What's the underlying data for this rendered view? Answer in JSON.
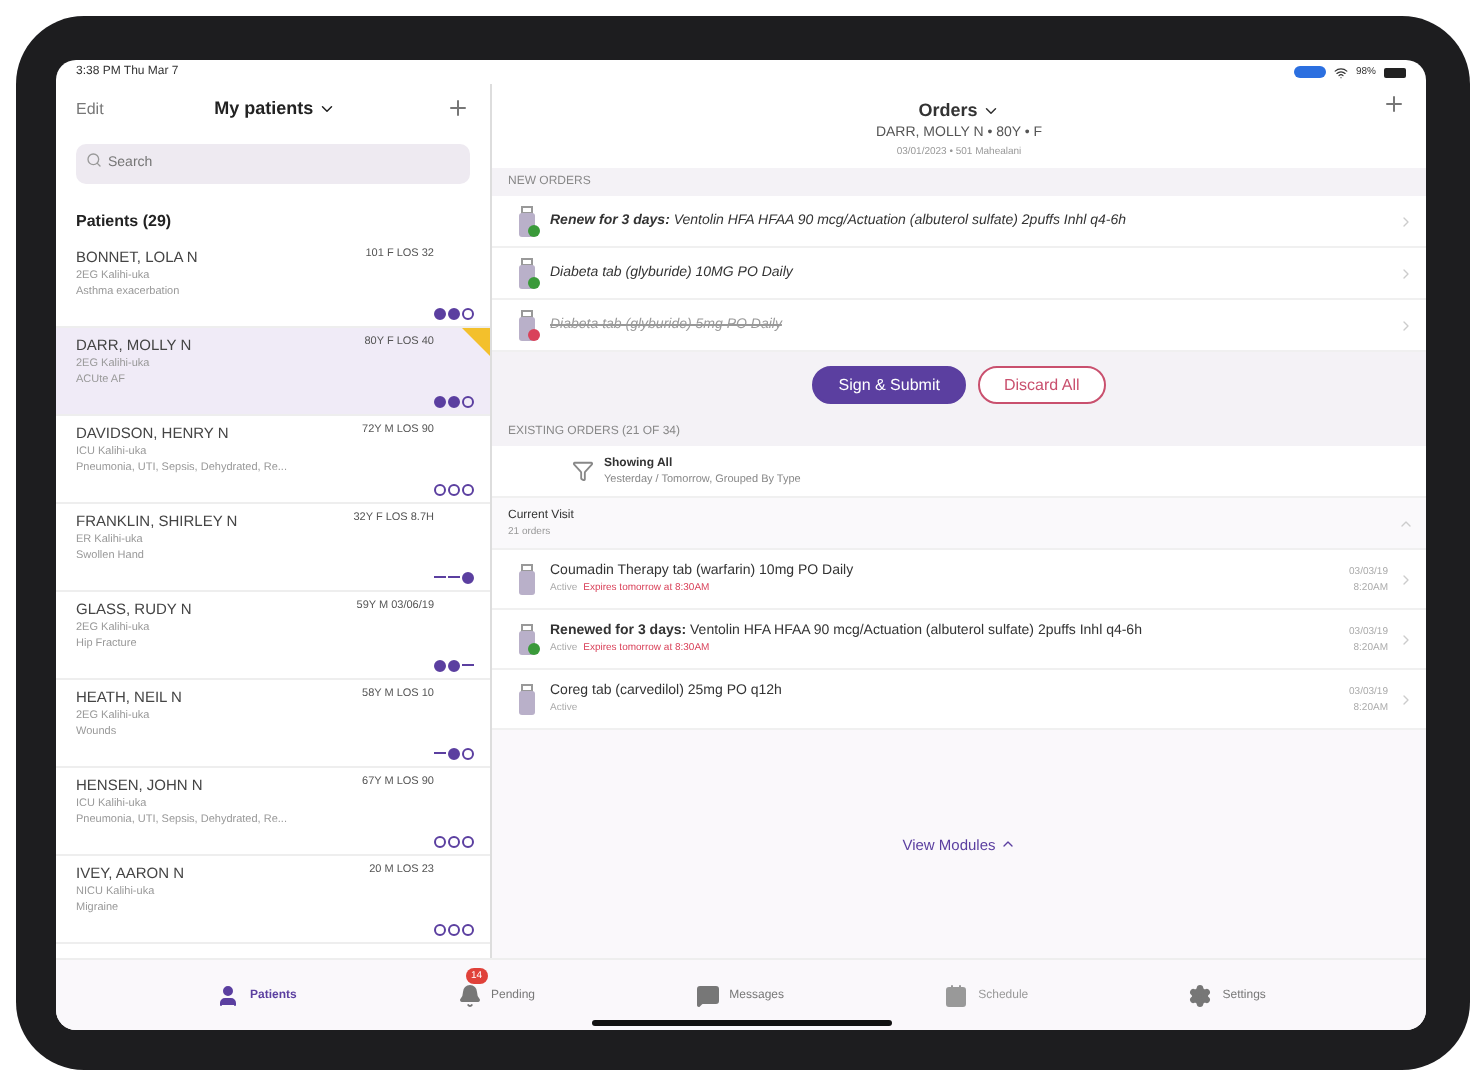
{
  "status_bar": {
    "time": "3:38 PM  Thu Mar 7",
    "battery": "98%"
  },
  "sidebar": {
    "edit": "Edit",
    "title": "My patients",
    "search": {
      "placeholder": "Search"
    },
    "list_title": "Patients (29)",
    "patients": [
      {
        "name": "BONNET, LOLA N",
        "info": "101 F LOS 32",
        "location": "2EG Kalihi-uka",
        "diagnosis": "Asthma exacerbation",
        "selected": false,
        "flagged": false,
        "indicators": [
          {
            "kind": "filled"
          },
          {
            "kind": "filled"
          },
          {
            "kind": "empty"
          }
        ]
      },
      {
        "name": "DARR, MOLLY N",
        "info": "80Y F LOS 40",
        "location": "2EG Kalihi-uka",
        "diagnosis": "ACUte AF",
        "selected": true,
        "flagged": true,
        "indicators": [
          {
            "kind": "filled"
          },
          {
            "kind": "filled"
          },
          {
            "kind": "empty"
          }
        ]
      },
      {
        "name": "DAVIDSON, HENRY N",
        "info": "72Y M LOS 90",
        "location": "ICU Kalihi-uka",
        "diagnosis": "Pneumonia, UTI, Sepsis, Dehydrated, Re...",
        "selected": false,
        "flagged": false,
        "indicators": [
          {
            "kind": "empty"
          },
          {
            "kind": "empty"
          },
          {
            "kind": "empty"
          }
        ]
      },
      {
        "name": "FRANKLIN, SHIRLEY N",
        "info": "32Y F LOS 8.7H",
        "location": "ER Kalihi-uka",
        "diagnosis": "Swollen Hand",
        "selected": false,
        "flagged": false,
        "indicators": [
          {
            "kind": "dash"
          },
          {
            "kind": "dash"
          },
          {
            "kind": "filled"
          }
        ]
      },
      {
        "name": "GLASS, RUDY N",
        "info": "59Y M 03/06/19",
        "location": "2EG Kalihi-uka",
        "diagnosis": "Hip Fracture",
        "selected": false,
        "flagged": false,
        "indicators": [
          {
            "kind": "filled"
          },
          {
            "kind": "filled"
          },
          {
            "kind": "dash"
          }
        ]
      },
      {
        "name": "HEATH, NEIL N",
        "info": "58Y M LOS 10",
        "location": "2EG Kalihi-uka",
        "diagnosis": "Wounds",
        "selected": false,
        "flagged": false,
        "indicators": [
          {
            "kind": "dash"
          },
          {
            "kind": "filled"
          },
          {
            "kind": "empty"
          }
        ]
      },
      {
        "name": "HENSEN, JOHN N",
        "info": "67Y M LOS 90",
        "location": "ICU Kalihi-uka",
        "diagnosis": "Pneumonia, UTI, Sepsis, Dehydrated, Re...",
        "selected": false,
        "flagged": false,
        "indicators": [
          {
            "kind": "empty"
          },
          {
            "kind": "empty"
          },
          {
            "kind": "empty"
          }
        ]
      },
      {
        "name": "IVEY, AARON N",
        "info": "20 M LOS 23",
        "location": "NICU Kalihi-uka",
        "diagnosis": "Migraine",
        "selected": false,
        "flagged": false,
        "indicators": [
          {
            "kind": "empty"
          },
          {
            "kind": "empty"
          },
          {
            "kind": "empty"
          }
        ]
      }
    ]
  },
  "orders": {
    "title": "Orders",
    "patient": "DARR, MOLLY N • 80Y • F",
    "patient_sub": "03/01/2023 • 501 Mahealani",
    "new_label": "NEW ORDERS",
    "new_orders": [
      {
        "text": "**Renew for 3 days:** Ventolin HFA HFAA 90 mcg/Actuation (albuterol sulfate) 2puffs Inhl q4-6h",
        "kind": "renew"
      },
      {
        "text": "Diabeta tab (glyburide) 10MG PO Daily",
        "kind": "new"
      },
      {
        "text": "Diabeta tab (glyburide) 5mg PO Daily",
        "kind": "discontinue"
      }
    ],
    "sign_button": "Sign & Submit",
    "discard_button": "Discard All",
    "existing_label": "EXISTING ORDERS (21 OF 34)",
    "filter": {
      "title": "Showing All",
      "subtitle": "Yesterday / Tomorrow, Grouped By Type"
    },
    "group": {
      "title": "Current Visit",
      "count": "21 orders"
    },
    "existing_orders": [
      {
        "text": "Coumadin Therapy tab (warfarin) 10mg PO Daily",
        "status": "Active",
        "warning": "Expires tomorrow at 8:30AM",
        "date": "03/03/19",
        "time": "8:20AM",
        "renewed": false
      },
      {
        "text": "**Renewed for 3 days:** Ventolin HFA HFAA 90 mcg/Actuation (albuterol sulfate) 2puffs Inhl q4-6h",
        "status": "Active",
        "warning": "Expires tomorrow at 8:30AM",
        "date": "03/03/19",
        "time": "8:20AM",
        "renewed": true
      },
      {
        "text": "Coreg tab (carvedilol) 25mg PO q12h",
        "status": "Active",
        "date": "03/03/19",
        "time": "8:20AM",
        "renewed": false
      }
    ],
    "view_modules": "View Modules"
  },
  "tabs": [
    {
      "label": "Patients",
      "selected": true,
      "disabled": false
    },
    {
      "label": "Pending",
      "selected": false,
      "disabled": false,
      "badge": "14"
    },
    {
      "label": "Messages",
      "selected": false,
      "disabled": false
    },
    {
      "label": "Schedule",
      "selected": false,
      "disabled": true
    },
    {
      "label": "Settings",
      "selected": false,
      "disabled": false
    }
  ]
}
